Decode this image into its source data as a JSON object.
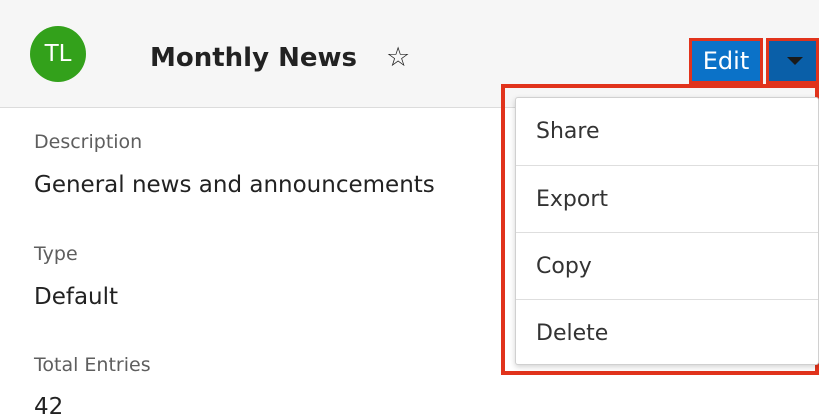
{
  "header": {
    "avatar_initials": "TL",
    "avatar_color": "#33a11b",
    "title": "Monthly News",
    "favorite_icon": "star-outline-icon",
    "edit_label": "Edit",
    "actions_menu_icon": "caret-down-icon",
    "button_color": "#0b72c8"
  },
  "fields": {
    "description": {
      "label": "Description",
      "value": "General news and announcements"
    },
    "type": {
      "label": "Type",
      "value": "Default"
    },
    "total_entries": {
      "label": "Total Entries",
      "value": "42"
    }
  },
  "actions_menu": {
    "items": [
      {
        "label": "Share"
      },
      {
        "label": "Export"
      },
      {
        "label": "Copy"
      },
      {
        "label": "Delete"
      }
    ]
  },
  "highlight_color": "#e1331c"
}
